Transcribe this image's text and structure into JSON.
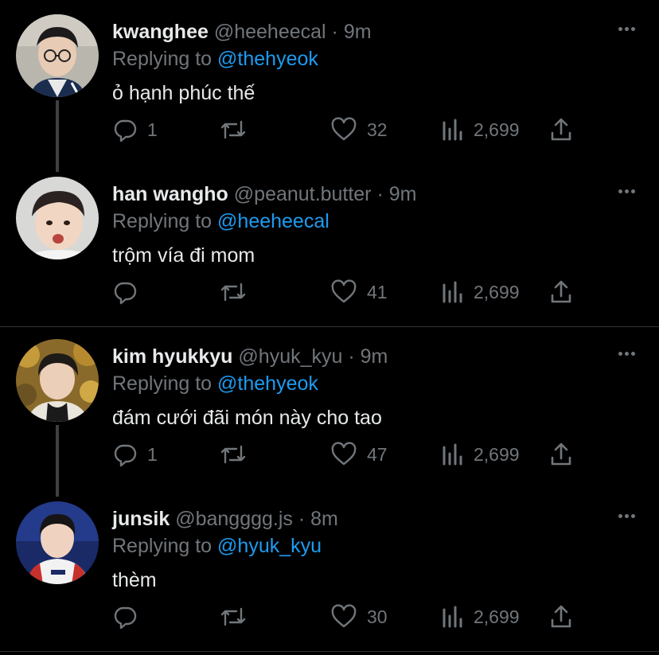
{
  "tweets": [
    {
      "name": "kwanghee",
      "handle": "@heeheecal",
      "separator": "·",
      "time": "9m",
      "replying_prefix": "Replying to",
      "replying_to": "@thehyeok",
      "text": "ỏ hạnh phúc thế",
      "replies": "1",
      "retweets": "",
      "likes": "32",
      "views": "2,699"
    },
    {
      "name": "han wangho",
      "handle": "@peanut.butter",
      "separator": "·",
      "time": "9m",
      "replying_prefix": "Replying to",
      "replying_to": "@heeheecal",
      "text": "trộm vía đi mom",
      "replies": "",
      "retweets": "",
      "likes": "41",
      "views": "2,699"
    },
    {
      "name": "kim hyukkyu",
      "handle": "@hyuk_kyu",
      "separator": "·",
      "time": "9m",
      "replying_prefix": "Replying to",
      "replying_to": "@thehyeok",
      "text": "đám cưới đãi món này cho tao",
      "replies": "1",
      "retweets": "",
      "likes": "47",
      "views": "2,699"
    },
    {
      "name": "junsik",
      "handle": "@bangggg.js",
      "separator": "·",
      "time": "8m",
      "replying_prefix": "Replying to",
      "replying_to": "@hyuk_kyu",
      "text": "thèm",
      "replies": "",
      "retweets": "",
      "likes": "30",
      "views": "2,699"
    }
  ],
  "colors": {
    "background": "#000000",
    "text": "#e7e9ea",
    "secondary": "#71767b",
    "mention": "#1d9bf0",
    "divider": "#2f3336"
  }
}
